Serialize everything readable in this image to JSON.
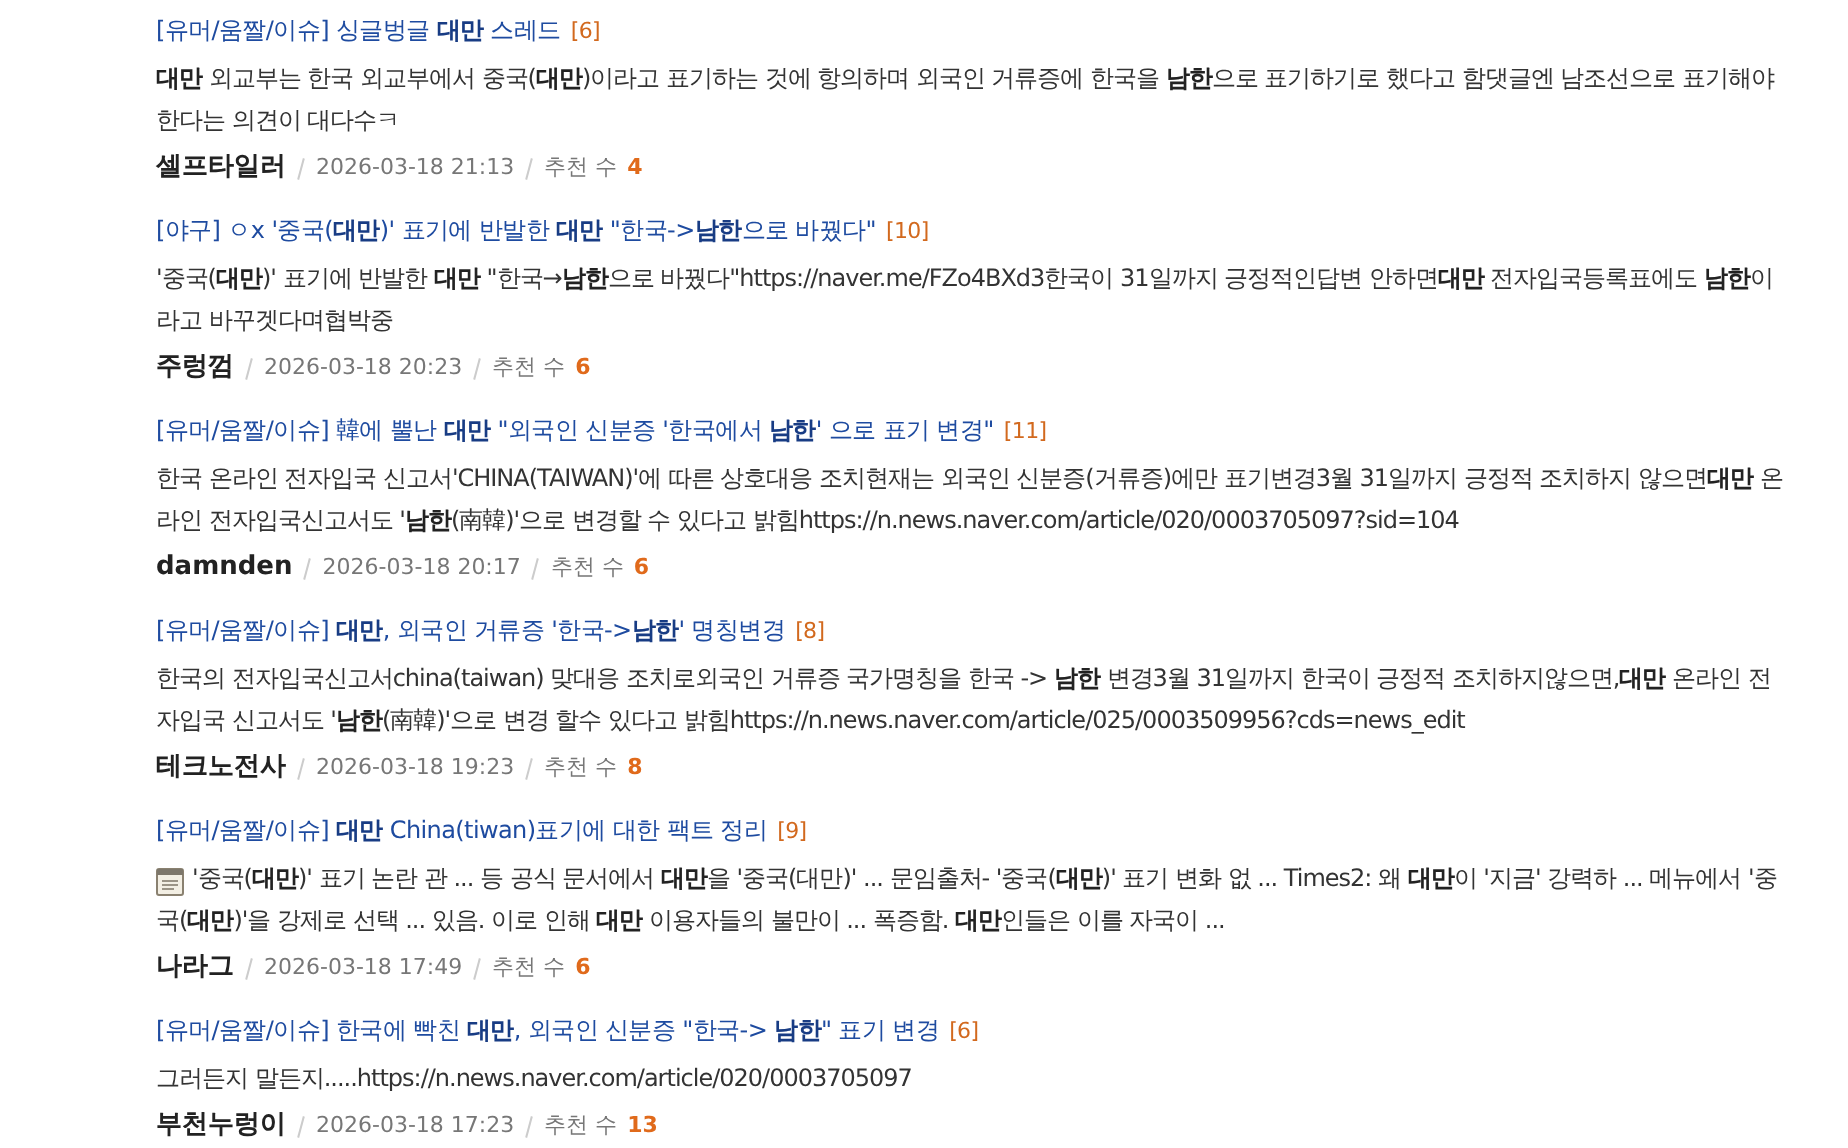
{
  "posts": [
    {
      "category": "[유머/움짤/이슈]",
      "title": "싱글벙글 **대만** 스레드",
      "comments": "[6]",
      "body": "**대만** 외교부는 한국 외교부에서 중국(**대만**)이라고 표기하는 것에 항의하며 외국인 거류증에 한국을 **남한**으로 표기하기로 했다고 함댓글엔 남조선으로 표기해야 한다는 의견이 대다수ㅋ",
      "author": "셀프타일러",
      "date": "2026-03-18 21:13",
      "recommend_label": "추천 수",
      "recommend": "4"
    },
    {
      "category": "[야구]",
      "title": "ㅇx '중국(**대만**)' 표기에 반발한 **대만** \"한국->**남한**으로 바꿨다\"",
      "comments": "[10]",
      "body": "'중국(**대만**)' 표기에 반발한 **대만** \"한국→**남한**으로 바꿨다\"https://naver.me/FZo4BXd3한국이 31일까지 긍정적인답변 안하면**대만** 전자입국등록표에도 **남한**이라고 바꾸겟다며협박중",
      "author": "주렁껌",
      "date": "2026-03-18 20:23",
      "recommend_label": "추천 수",
      "recommend": "6"
    },
    {
      "category": "[유머/움짤/이슈]",
      "title": "韓에 뿔난 **대만** \"외국인 신분증 '한국에서 **남한**' 으로 표기 변경\"",
      "comments": "[11]",
      "body": "한국 온라인 전자입국 신고서'CHINA(TAIWAN)'에 따른 상호대응 조치현재는 외국인 신분증(거류증)에만 표기변경3월 31일까지 긍정적 조치하지 않으면**대만** 온라인 전자입국신고서도 '**남한**(南韓)'으로 변경할 수 있다고 밝힘https://n.news.naver.com/article/020/0003705097?sid=104",
      "author": "damnden",
      "date": "2026-03-18 20:17",
      "recommend_label": "추천 수",
      "recommend": "6"
    },
    {
      "category": "[유머/움짤/이슈]",
      "title": "**대만**, 외국인 거류증 '한국->**남한**' 명칭변경",
      "comments": "[8]",
      "body": "한국의 전자입국신고서china(taiwan) 맞대응 조치로외국인 거류증 국가명칭을 한국 -> **남한** 변경3월 31일까지 한국이 긍정적 조치하지않으면,**대만** 온라인 전자입국 신고서도 '**남한**(南韓)'으로 변경 할수 있다고 밝힘https://n.news.naver.com/article/025/0003509956?cds=news_edit",
      "author": "테크노전사",
      "date": "2026-03-18 19:23",
      "recommend_label": "추천 수",
      "recommend": "8"
    },
    {
      "category": "[유머/움짤/이슈]",
      "title": "**대만** China(tiwan)표기에 대한 팩트 정리",
      "comments": "[9]",
      "has_memo_icon": true,
      "body": "'중국(**대만**)' 표기 논란 관 ... 등 공식 문서에서 **대만**을 '중국(대만)' ... 문임출처- '중국(**대만**)' 표기 변화 없 ... Times2: 왜 **대만**이 '지금' 강력하 ... 메뉴에서 '중국(**대만**)'을 강제로 선택 ... 있음. 이로 인해 **대만** 이용자들의 불만이 ... 폭증함. **대만**인들은 이를 자국이 ...",
      "author": "나라그",
      "date": "2026-03-18 17:49",
      "recommend_label": "추천 수",
      "recommend": "6"
    },
    {
      "category": "[유머/움짤/이슈]",
      "title": "한국에 빡친 **대만**, 외국인 신분증 \"한국-> **남한**\" 표기 변경",
      "comments": "[6]",
      "body": "그러든지 말든지.....https://n.news.naver.com/article/020/0003705097",
      "author": "부천누렁이",
      "date": "2026-03-18 17:23",
      "recommend_label": "추천 수",
      "recommend": "13"
    }
  ]
}
